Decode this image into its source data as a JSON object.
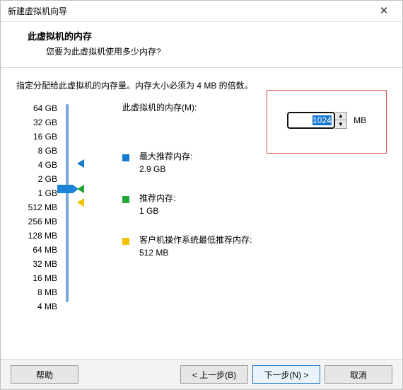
{
  "window": {
    "title": "新建虚拟机向导"
  },
  "header": {
    "title": "此虚拟机的内存",
    "subtitle": "您要为此虚拟机使用多少内存?"
  },
  "instruction": "指定分配给此虚拟机的内存量。内存大小必须为 4 MB 的倍数。",
  "memory": {
    "label": "此虚拟机的内存(M):",
    "value": "1024",
    "unit": "MB"
  },
  "scale": {
    "labels": [
      "64 GB",
      "32 GB",
      "16 GB",
      "8 GB",
      "4 GB",
      "2 GB",
      "1 GB",
      "512 MB",
      "256 MB",
      "128 MB",
      "64 MB",
      "32 MB",
      "16 MB",
      "8 MB",
      "4 MB"
    ]
  },
  "recommend": {
    "max": {
      "label": "最大推荐内存:",
      "value": "2.9 GB"
    },
    "rec": {
      "label": "推荐内存:",
      "value": "1 GB"
    },
    "min": {
      "label": "客户机操作系统最低推荐内存:",
      "value": "512 MB"
    }
  },
  "buttons": {
    "help": "帮助",
    "back": "< 上一步(B)",
    "next": "下一步(N) >",
    "cancel": "取消"
  }
}
